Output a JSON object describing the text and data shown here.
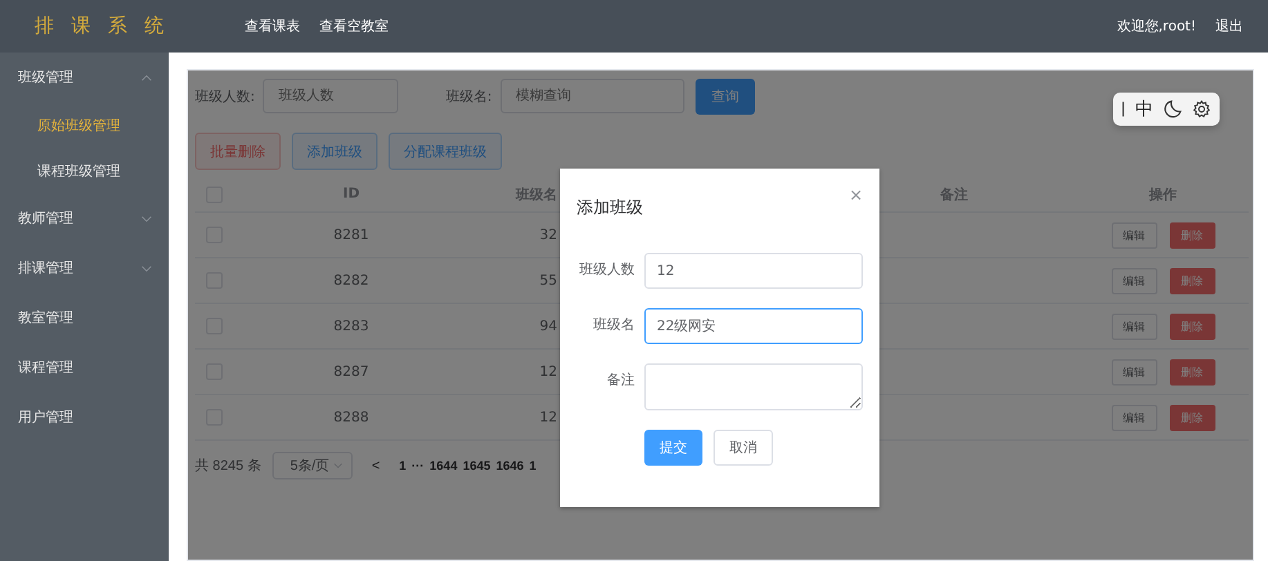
{
  "header": {
    "logo": "排 课 系 统",
    "nav": [
      "查看课表",
      "查看空教室"
    ],
    "welcome": "欢迎您,root!",
    "logout": "退出"
  },
  "sidebar": {
    "items": [
      {
        "label": "班级管理",
        "kind": "submenu",
        "expanded": true,
        "children": [
          {
            "label": "原始班级管理",
            "selected": true
          },
          {
            "label": "课程班级管理",
            "selected": false
          }
        ]
      },
      {
        "label": "教师管理",
        "kind": "submenu",
        "expanded": false
      },
      {
        "label": "排课管理",
        "kind": "submenu",
        "expanded": false
      },
      {
        "label": "教室管理",
        "kind": "item"
      },
      {
        "label": "课程管理",
        "kind": "item"
      },
      {
        "label": "用户管理",
        "kind": "item"
      }
    ]
  },
  "search": {
    "fields": [
      {
        "label": "班级人数:",
        "placeholder": "班级人数"
      },
      {
        "label": "班级名:",
        "placeholder": "模糊查询"
      }
    ],
    "button": "查询"
  },
  "actions": [
    {
      "label": "批量删除",
      "kind": "danger"
    },
    {
      "label": "添加班级",
      "kind": "primary"
    },
    {
      "label": "分配课程班级",
      "kind": "primary"
    }
  ],
  "table": {
    "header_checked": false,
    "columns": [
      "ID",
      "班级名",
      "备注",
      "操作"
    ],
    "rows": [
      {
        "checked": false,
        "id": "8281",
        "column_3": "32",
        "edit": "编辑",
        "delete": "删除"
      },
      {
        "checked": false,
        "id": "8282",
        "column_3": "55",
        "edit": "编辑",
        "delete": "删除"
      },
      {
        "checked": false,
        "id": "8283",
        "column_3": "94",
        "edit": "编辑",
        "delete": "删除"
      },
      {
        "checked": false,
        "id": "8287",
        "column_3": "12",
        "edit": "编辑",
        "delete": "删除"
      },
      {
        "checked": false,
        "id": "8288",
        "column_3": "12",
        "edit": "编辑",
        "delete": "删除"
      }
    ]
  },
  "pagination": {
    "total": "共 8245 条",
    "page_size": "5条/页",
    "prev": "<",
    "pages": [
      "1",
      "···",
      "1644",
      "1645",
      "1646",
      "1"
    ]
  },
  "dialog": {
    "title": "添加班级",
    "close": "×",
    "fields": [
      {
        "label": "班级人数",
        "value": "12",
        "kind": "input",
        "focused": false
      },
      {
        "label": "班级名",
        "value": "22级网安",
        "kind": "input",
        "focused": true
      },
      {
        "label": "备注",
        "kind": "textarea",
        "focused": false
      }
    ],
    "submit": "提交",
    "cancel": "取消"
  },
  "ime_toolbar": {
    "mode": "中"
  }
}
